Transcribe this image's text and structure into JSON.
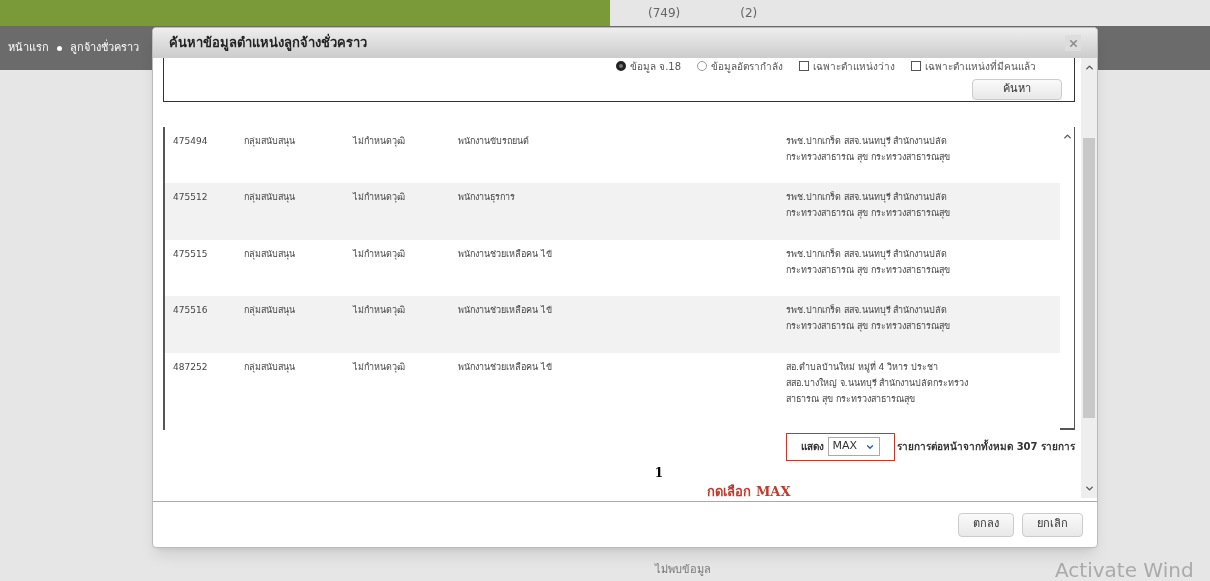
{
  "top_bar": {
    "counts": [
      "(749)",
      "(2)"
    ]
  },
  "breadcrumb": [
    "หน้าแรก",
    "ลูกจ้างชั่วคราว"
  ],
  "dialog": {
    "title": "ค้นหาข้อมูลตำแหน่งลูกจ้างชั่วคราว",
    "radios": [
      {
        "label": "ข้อมูล จ.18",
        "selected": true
      },
      {
        "label": "ข้อมูลอัตรากำลัง",
        "selected": false
      }
    ],
    "checkboxes": [
      {
        "label": "เฉพาะตำแหน่งว่าง",
        "checked": false
      },
      {
        "label": "เฉพาะตำแหน่งที่มีคนแล้ว",
        "checked": false
      }
    ],
    "search_button": "ค้นหา",
    "rows": [
      {
        "cells": [
          "475494",
          "กลุ่มสนับสนุน",
          "ไม่กำหนดวุฒิ",
          "พนักงานขับรถยนต์",
          "รพช.ปากเกร็ด สสจ.นนทบุรี สำนักงานปลัดกระทรวงสาธารณ สุข กระทรวงสาธารณสุข"
        ]
      },
      {
        "cells": [
          "475512",
          "กลุ่มสนับสนุน",
          "ไม่กำหนดวุฒิ",
          "พนักงานธุรการ",
          "รพช.ปากเกร็ด สสจ.นนทบุรี สำนักงานปลัดกระทรวงสาธารณ สุข กระทรวงสาธารณสุข"
        ]
      },
      {
        "cells": [
          "475515",
          "กลุ่มสนับสนุน",
          "ไม่กำหนดวุฒิ",
          "พนักงานช่วยเหลือคน ไข้",
          "รพช.ปากเกร็ด สสจ.นนทบุรี สำนักงานปลัดกระทรวงสาธารณ สุข กระทรวงสาธารณสุข"
        ]
      },
      {
        "cells": [
          "475516",
          "กลุ่มสนับสนุน",
          "ไม่กำหนดวุฒิ",
          "พนักงานช่วยเหลือคน ไข้",
          "รพช.ปากเกร็ด สสจ.นนทบุรี สำนักงานปลัดกระทรวงสาธารณ สุข กระทรวงสาธารณสุข"
        ]
      },
      {
        "cells": [
          "487252",
          "กลุ่มสนับสนุน",
          "ไม่กำหนดวุฒิ",
          "พนักงานช่วยเหลือคน ไข้",
          "สอ.ตำบลบ้านใหม่ หมู่ที่ 4 วิหาร ประชา สสอ.บางใหญ่ จ.นนทบุรี สำนักงานปลัดกระทรวงสาธารณ สุข กระทรวงสาธารณสุข"
        ]
      }
    ],
    "page_size": {
      "label": "แสดง",
      "value": "MAX",
      "suffix": "รายการต่อหน้าจากทั้งหมด 307 รายการ"
    },
    "page": "1",
    "annotation": "กดเลือก MAX",
    "buttons": [
      "ตกลง",
      "ยกเลิก"
    ]
  },
  "background": {
    "message": "ไม่พบข้อมูล",
    "os_notice": "Activate Wind"
  }
}
